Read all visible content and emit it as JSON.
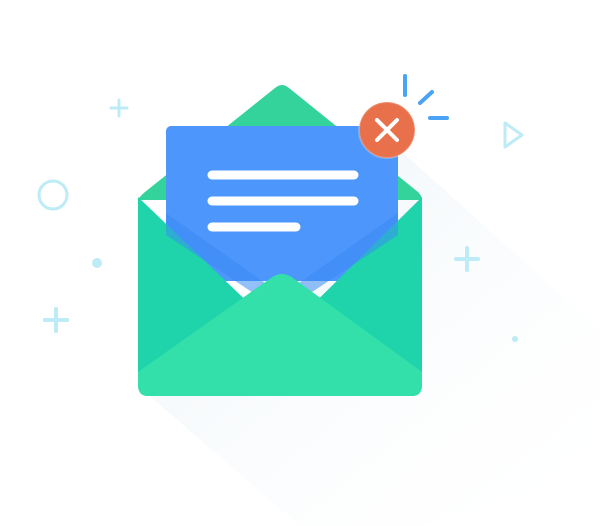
{
  "illustration": {
    "subject": "open-envelope-with-error",
    "icons": {
      "envelope": "envelope-open-icon",
      "letter": "letter-icon",
      "error_badge": "close-icon",
      "play": "play-icon",
      "ring": "circle-icon"
    },
    "colors": {
      "envelope_back": "#34D39C",
      "envelope_body": "#1FD4AA",
      "envelope_front": "#33E0A9",
      "letter": "#4D96FC",
      "letter_lines": "#FFFFFF",
      "error_badge": "#E8704A",
      "accent_light": "#BDEBF6",
      "ray_blue": "#4AA3F4",
      "shadow": "#EEF4F8"
    },
    "letter_line_count": 3,
    "error_state": true
  }
}
